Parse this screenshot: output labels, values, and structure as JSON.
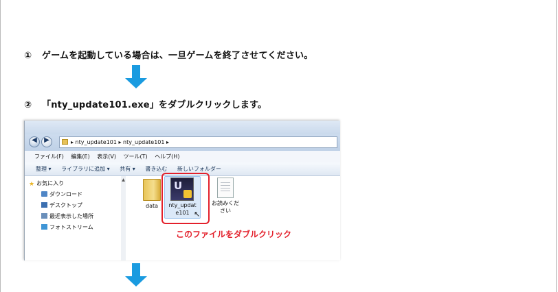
{
  "steps": [
    {
      "number": "①",
      "text": "ゲームを起動している場合は、一旦ゲームを終了させてください。"
    },
    {
      "number": "②",
      "text": "「nty_update101.exe」をダブルクリックします。"
    }
  ],
  "explorer": {
    "breadcrumb": "▸  nty_update101  ▸  nty_update101  ▸",
    "menu": [
      "ファイル(F)",
      "編集(E)",
      "表示(V)",
      "ツール(T)",
      "ヘルプ(H)"
    ],
    "toolbar": [
      "整理 ▾",
      "ライブラリに追加 ▾",
      "共有 ▾",
      "書き込む",
      "新しいフォルダー"
    ],
    "nav": {
      "favorites": "お気に入り",
      "items": [
        "ダウンロード",
        "デスクトップ",
        "最近表示した場所",
        "フォトストリーム"
      ]
    },
    "files": {
      "folder": "data",
      "exe_line1": "nty_updat",
      "exe_line2": "e101",
      "doc_line1": "お読みくだ",
      "doc_line2": "さい"
    }
  },
  "callout": "このファイルをダブルクリック",
  "colors": {
    "arrow": "#1a9be0",
    "highlight": "#e3202b"
  }
}
